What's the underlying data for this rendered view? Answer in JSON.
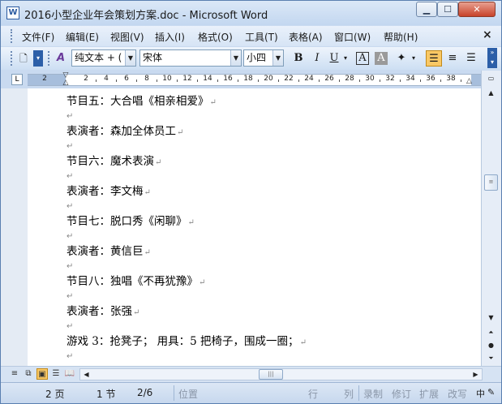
{
  "window": {
    "title": "2016小型企业年会策划方案.doc - Microsoft Word",
    "icon_text": "W",
    "minimize_glyph": "▁",
    "maximize_glyph": "☐",
    "close_glyph": "✕"
  },
  "menu": {
    "items": [
      "文件(F)",
      "编辑(E)",
      "视图(V)",
      "插入(I)",
      "格式(O)",
      "工具(T)",
      "表格(A)",
      "窗口(W)",
      "帮助(H)"
    ],
    "close_glyph": "×"
  },
  "toolbar": {
    "style_value": "纯文本 + (",
    "font_value": "宋体",
    "size_value": "小四",
    "bold": "B",
    "italic": "I",
    "underline": "U",
    "text_border": "A",
    "char_shading": "A",
    "highlight_arrow": "▾",
    "style_icon_text": "A"
  },
  "ruler": {
    "tab_glyph": "L",
    "numbers": [
      "2",
      "2",
      "4",
      "6",
      "8",
      "10",
      "12",
      "14",
      "16",
      "18",
      "20",
      "22",
      "24",
      "26",
      "28",
      "30",
      "32",
      "34",
      "36",
      "38"
    ]
  },
  "document": {
    "paragraph_mark": "↵",
    "lines": [
      "节目五：大合唱《相亲相爱》",
      "表演者：森加全体员工",
      "节目六：魔术表演",
      "表演者：李文梅",
      "节目七：脱口秀《闲聊》",
      "表演者：黄信巨",
      "节目八：独唱《不再犹豫》",
      "表演者：张强",
      "游戏 3：抢凳子；  用具：5 把椅子，围成一圈；"
    ]
  },
  "status": {
    "page": "2 页",
    "section": "1 节",
    "page_of": "2/6",
    "position": "位置",
    "line": "行",
    "column": "列",
    "record": "录制",
    "revise": "修订",
    "extend": "扩展",
    "overwrite": "改写"
  },
  "colors": {
    "chrome": "#c9daf0",
    "highlight": "#f9c865",
    "page": "#ffffff"
  }
}
